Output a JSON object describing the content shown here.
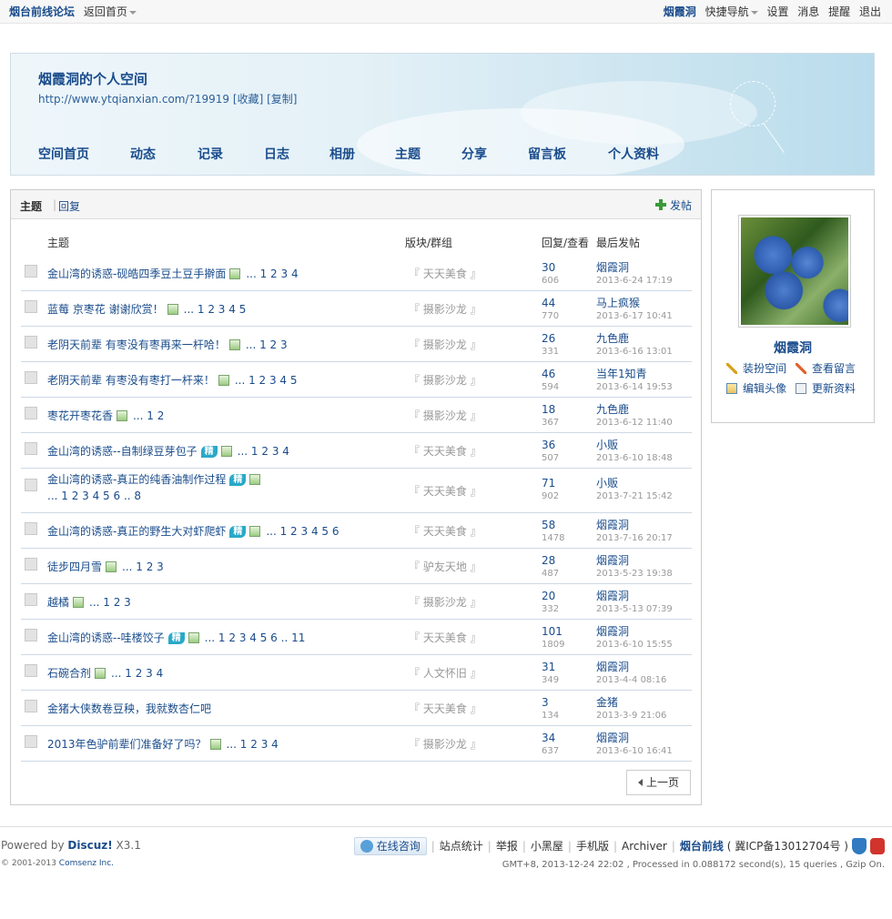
{
  "toolbar": {
    "site_name": "烟台前线论坛",
    "back_home": "返回首页",
    "username": "烟霞洞",
    "quick_nav": "快捷导航",
    "settings": "设置",
    "messages": "消息",
    "remind": "提醒",
    "logout": "退出"
  },
  "space": {
    "title": "烟霞洞的个人空间",
    "url": "http://www.ytqianxian.com/?19919",
    "favorite": "[收藏]",
    "copy": "[复制]",
    "nav": [
      "空间首页",
      "动态",
      "记录",
      "日志",
      "相册",
      "主题",
      "分享",
      "留言板",
      "个人资料"
    ]
  },
  "main": {
    "tab_topics": "主题",
    "tab_reply": "回复",
    "post_button": "发帖",
    "col_topic": "主题",
    "col_forum": "版块/群组",
    "col_stats": "回复/查看",
    "col_last": "最后发帖",
    "prev_page": "上一页",
    "rows": [
      {
        "title": "金山湾的诱惑-砚皓四季豆土豆手擀面",
        "jing": "",
        "pages": "... 1 2 3 4",
        "pages2": "",
        "forum": "『 天天美食 』",
        "replies": "30",
        "views": "606",
        "last_user": "烟霞洞",
        "last_time": "2013-6-24 17:19"
      },
      {
        "title": "蓝莓 京枣花 谢谢欣赏！",
        "jing": "",
        "pages": "... 1 2 3 4 5",
        "pages2": "",
        "forum": "『 摄影沙龙 』",
        "replies": "44",
        "views": "770",
        "last_user": "马上疯猴",
        "last_time": "2013-6-17 10:41"
      },
      {
        "title": "老阴天前辈 有枣没有枣再来一杆哈！",
        "jing": "",
        "pages": "... 1 2 3",
        "pages2": "",
        "forum": "『 摄影沙龙 』",
        "replies": "26",
        "views": "331",
        "last_user": "九色鹿",
        "last_time": "2013-6-16 13:01"
      },
      {
        "title": "老阴天前辈 有枣没有枣打一杆来！",
        "jing": "",
        "pages": "... 1 2 3 4 5",
        "pages2": "",
        "forum": "『 摄影沙龙 』",
        "replies": "46",
        "views": "594",
        "last_user": "当年1知青",
        "last_time": "2013-6-14 19:53"
      },
      {
        "title": "枣花开枣花香",
        "jing": "",
        "pages": "... 1 2",
        "pages2": "",
        "forum": "『 摄影沙龙 』",
        "replies": "18",
        "views": "367",
        "last_user": "九色鹿",
        "last_time": "2013-6-12 11:40"
      },
      {
        "title": "金山湾的诱惑--自制绿豆芽包子",
        "jing": "精",
        "pages": "... 1 2 3 4",
        "pages2": "",
        "forum": "『 天天美食 』",
        "replies": "36",
        "views": "507",
        "last_user": "小贩",
        "last_time": "2013-6-10 18:48"
      },
      {
        "title": "金山湾的诱惑-真正的纯香油制作过程",
        "jing": "精",
        "pages": "",
        "pages2": "... 1 2 3 4 5 6 .. 8",
        "forum": "『 天天美食 』",
        "replies": "71",
        "views": "902",
        "last_user": "小贩",
        "last_time": "2013-7-21 15:42"
      },
      {
        "title": "金山湾的诱惑-真正的野生大对虾爬虾",
        "jing": "精",
        "pages": "... 1 2 3 4 5 6",
        "pages2": "",
        "forum": "『 天天美食 』",
        "replies": "58",
        "views": "1478",
        "last_user": "烟霞洞",
        "last_time": "2013-7-16 20:17"
      },
      {
        "title": "徒步四月雪",
        "jing": "",
        "pages": "... 1 2 3",
        "pages2": "",
        "forum": "『 驴友天地 』",
        "replies": "28",
        "views": "487",
        "last_user": "烟霞洞",
        "last_time": "2013-5-23 19:38"
      },
      {
        "title": "越橘",
        "jing": "",
        "pages": "... 1 2 3",
        "pages2": "",
        "forum": "『 摄影沙龙 』",
        "replies": "20",
        "views": "332",
        "last_user": "烟霞洞",
        "last_time": "2013-5-13 07:39"
      },
      {
        "title": "金山湾的诱惑--哇楼饺子",
        "jing": "精",
        "pages": "... 1 2 3 4 5 6 .. 11",
        "pages2": "",
        "forum": "『 天天美食 』",
        "replies": "101",
        "views": "1809",
        "last_user": "烟霞洞",
        "last_time": "2013-6-10 15:55"
      },
      {
        "title": "石碗合剂",
        "jing": "",
        "pages": "... 1 2 3 4",
        "pages2": "",
        "forum": "『 人文怀旧 』",
        "replies": "31",
        "views": "349",
        "last_user": "烟霞洞",
        "last_time": "2013-4-4 08:16"
      },
      {
        "title": "金猪大侠数卷豆秧，我就数杏仁吧",
        "jing": "",
        "pages": "",
        "pages2": "",
        "forum": "『 天天美食 』",
        "replies": "3",
        "views": "134",
        "last_user": "金猪",
        "last_time": "2013-3-9 21:06"
      },
      {
        "title": "2013年色驴前辈们准备好了吗？",
        "jing": "",
        "pages": "... 1 2 3 4",
        "pages2": "",
        "forum": "『 摄影沙龙 』",
        "replies": "34",
        "views": "637",
        "last_user": "烟霞洞",
        "last_time": "2013-6-10 16:41"
      }
    ]
  },
  "profile": {
    "name": "烟霞洞",
    "decorate": "装扮空间",
    "view_msgs": "查看留言",
    "edit_avatar": "编辑头像",
    "update_info": "更新资料"
  },
  "footer": {
    "powered_prefix": "Powered by ",
    "powered_brand": "Discuz!",
    "powered_ver": " X3.1",
    "copyright": "© 2001-2013 ",
    "company": "Comsenz Inc.",
    "consult": "在线咨询",
    "stats": "站点统计",
    "report": "举报",
    "blackroom": "小黑屋",
    "mobile": "手机版",
    "archiver": "Archiver",
    "site": "烟台前线",
    "icp": "( 冀ICP备13012704号 )",
    "gmt": "GMT+8, 2013-12-24 22:02 , Processed in 0.088172 second(s), 15 queries , Gzip On."
  }
}
